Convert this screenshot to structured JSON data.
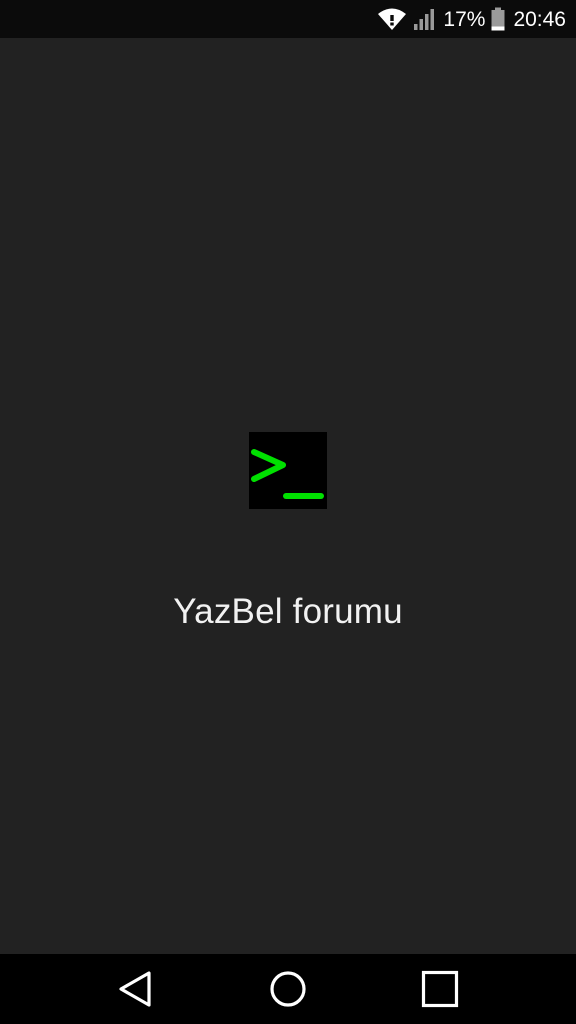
{
  "status_bar": {
    "battery_percent": "17%",
    "time": "20:46",
    "icons": [
      "wifi-icon",
      "signal-icon",
      "battery-icon"
    ]
  },
  "splash": {
    "logo_icon": "terminal-prompt-icon",
    "logo_colors": {
      "background": "#000000",
      "glyph": "#00e000"
    },
    "app_title": "YazBel forumu"
  },
  "nav_bar": {
    "buttons": [
      "back-button",
      "home-button",
      "recents-button"
    ]
  },
  "colors": {
    "background": "#222222",
    "status_bar": "#0b0b0b",
    "nav_bar": "#000000",
    "text": "#f2f2f2"
  }
}
